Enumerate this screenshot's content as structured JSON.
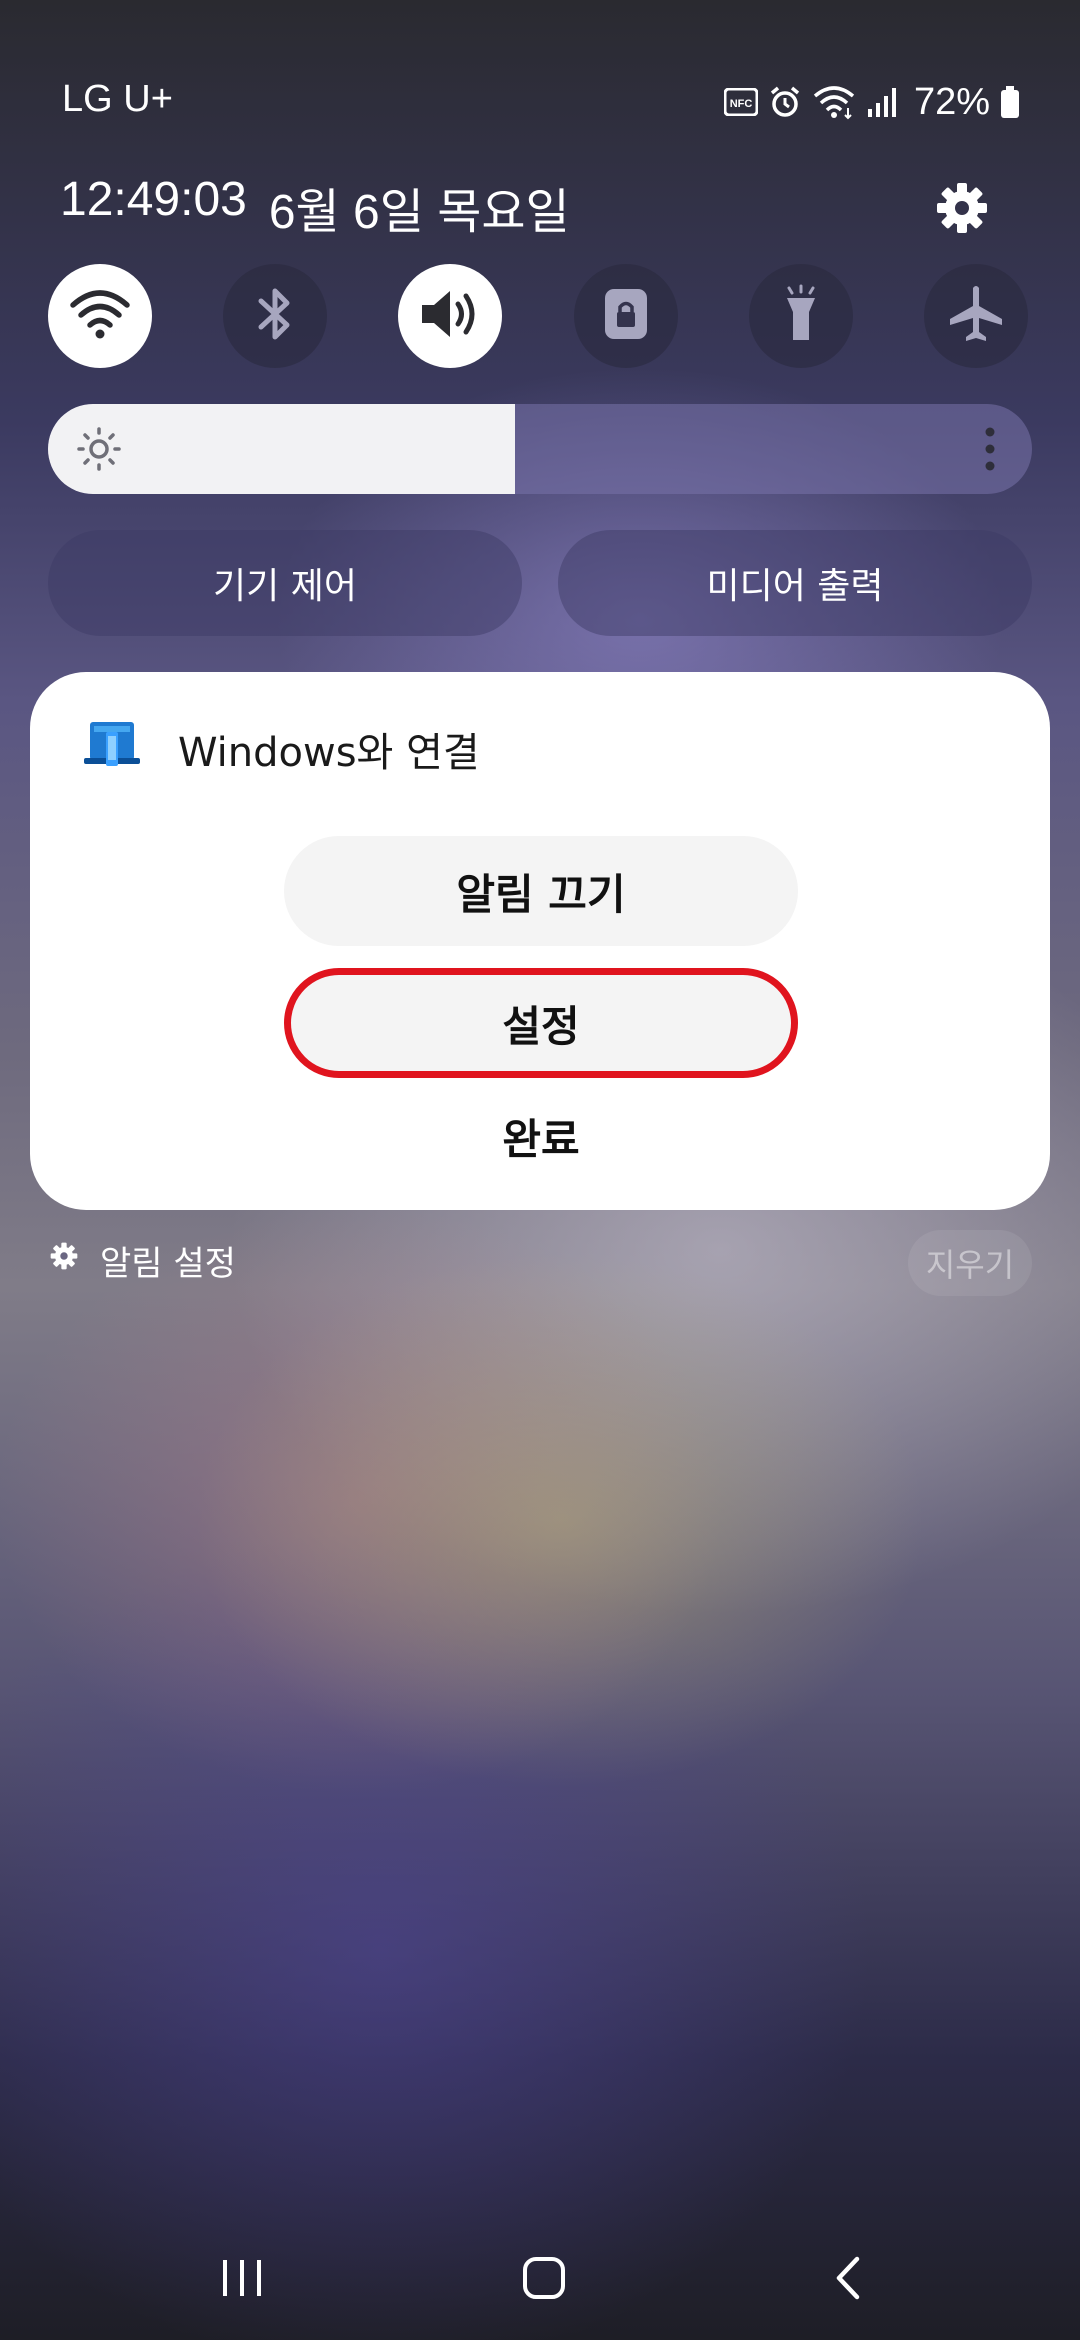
{
  "status_bar": {
    "carrier": "LG U+",
    "battery_percent": "72%",
    "icons": [
      "nfc-icon",
      "alarm-icon",
      "wifi-icon",
      "signal-icon",
      "battery-icon"
    ]
  },
  "header": {
    "time": "12:49:03",
    "date": "6월 6일 목요일"
  },
  "quick_toggles": [
    {
      "name": "wifi",
      "icon": "wifi-icon",
      "on": true
    },
    {
      "name": "bluetooth",
      "icon": "bluetooth-icon",
      "on": false
    },
    {
      "name": "sound",
      "icon": "sound-icon",
      "on": true
    },
    {
      "name": "rotation-lock",
      "icon": "lock-icon",
      "on": false
    },
    {
      "name": "flashlight",
      "icon": "flashlight-icon",
      "on": false
    },
    {
      "name": "airplane",
      "icon": "airplane-icon",
      "on": false
    }
  ],
  "brightness": {
    "level": 0.475
  },
  "panel_buttons": {
    "device_control": "기기 제어",
    "media_output": "미디어 출력"
  },
  "notification": {
    "app_title": "Windows와 연결",
    "mute_label": "알림 끄기",
    "settings_label": "설정",
    "done_label": "완료",
    "highlight_color": "#e0141e"
  },
  "footer": {
    "notification_settings": "알림 설정",
    "clear": "지우기"
  }
}
